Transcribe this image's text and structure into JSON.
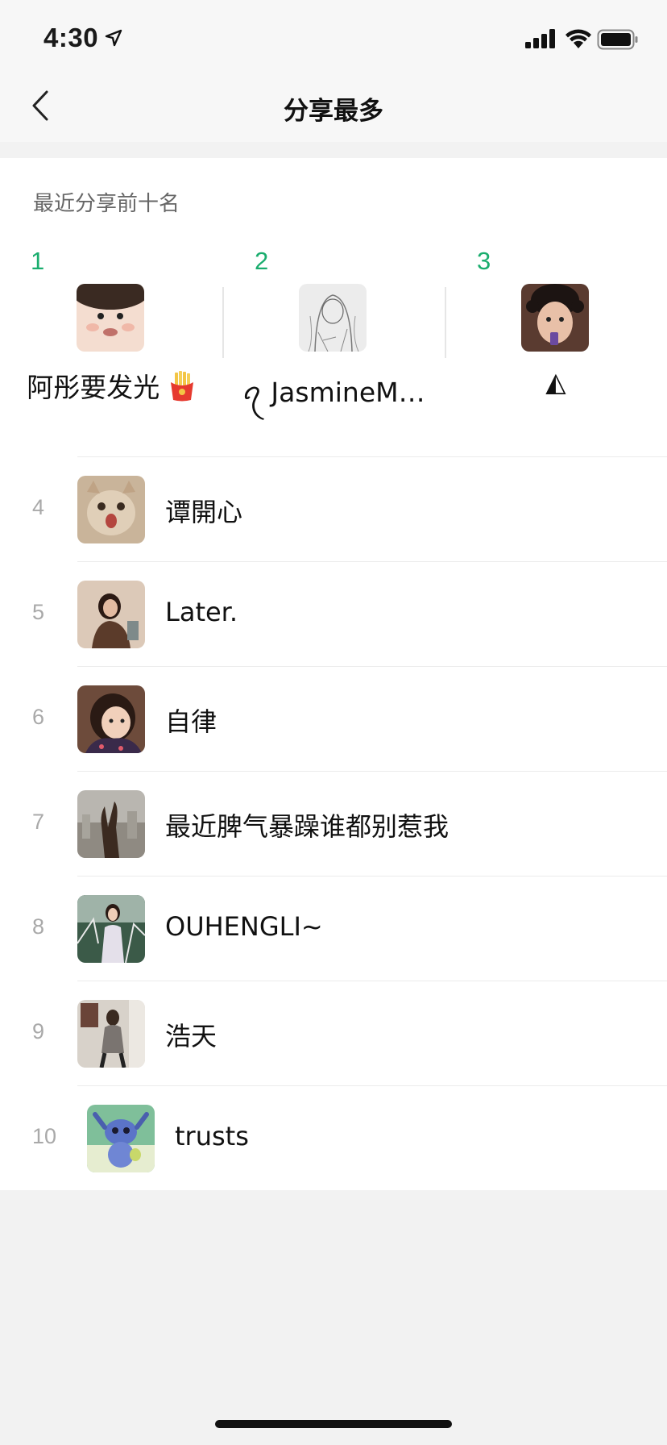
{
  "status_bar": {
    "time": "4:30"
  },
  "nav": {
    "title": "分享最多"
  },
  "section_title": "最近分享前十名",
  "accent_color": "#1aad6e",
  "top3": [
    {
      "rank": "1",
      "name": "阿彤要发光"
    },
    {
      "rank": "2",
      "name": "ꪖ JasmineM…"
    },
    {
      "rank": "3",
      "name": "◭"
    }
  ],
  "list": [
    {
      "rank": "4",
      "name": "谭開心"
    },
    {
      "rank": "5",
      "name": "Later."
    },
    {
      "rank": "6",
      "name": "自律"
    },
    {
      "rank": "7",
      "name": "最近脾气暴躁谁都别惹我"
    },
    {
      "rank": "8",
      "name": "OUHENGLI~"
    },
    {
      "rank": "9",
      "name": "浩天"
    },
    {
      "rank": "10",
      "name": "trusts"
    }
  ]
}
